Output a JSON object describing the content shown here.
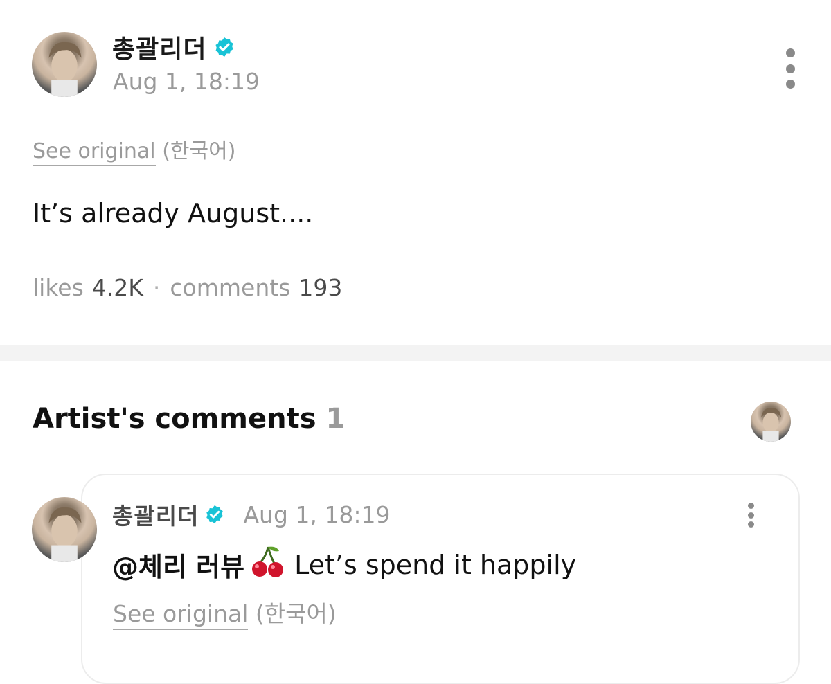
{
  "post": {
    "author": "총괄리더",
    "timestamp": "Aug 1, 18:19",
    "see_original": "See original",
    "language": "(한국어)",
    "body": "It’s already August....",
    "likes_label": "likes",
    "likes_count": "4.2K",
    "separator": "·",
    "comments_label": "comments",
    "comments_count": "193"
  },
  "artist_comments": {
    "title": "Artist's comments",
    "count": "1",
    "comment": {
      "author": "총괄리더",
      "timestamp": "Aug 1, 18:19",
      "mention": "@체리 러뷰",
      "emoji": "cherry-emoji",
      "text": "Let’s spend it happily",
      "see_original": "See original",
      "language": "(한국어)"
    }
  },
  "colors": {
    "verified": "#19c3d6",
    "muted_text": "#9a9a9a",
    "divider": "#f3f3f3",
    "card_border": "#ececec"
  },
  "icons": {
    "verified": "verified-badge-icon",
    "menu": "more-vertical-icon",
    "avatar": "user-avatar"
  }
}
